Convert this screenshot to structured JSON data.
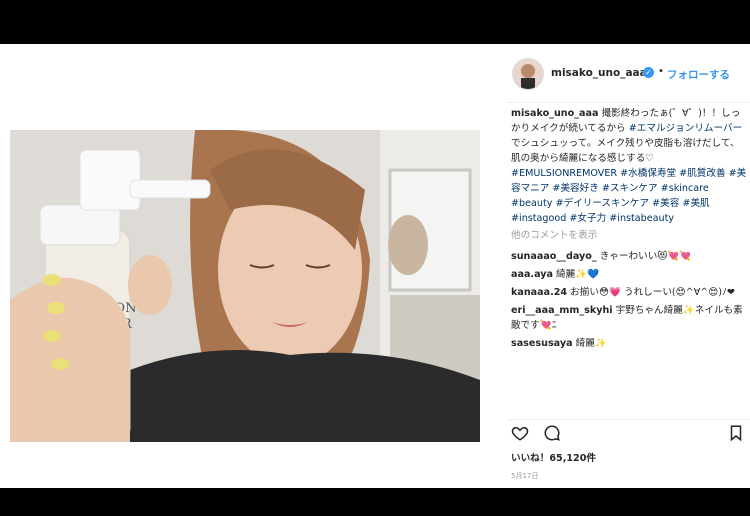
{
  "post": {
    "username": "misako_uno_aaa",
    "verified_icon": "verified-badge-icon",
    "dot": "•",
    "follow_label": "フォローする"
  },
  "caption": {
    "username": "misako_uno_aaa",
    "text": "撮影終わったぁ(゜∀゜)！！しっかりメイクが続いてるから",
    "tag1": "#エマルジョンリムーバー",
    "text2": "でシュシュッって。メイク残りや皮脂も溶けだして、肌の奥から綺麗になる感じする♡",
    "tags": "#EMULSIONREMOVER #水橋保寿堂 #肌質改善 #美容マニア #美容好き #スキンケア #skincare #beauty #デイリースキンケア #美容 #美肌 #instagood #女子力 #instabeauty"
  },
  "more_comments_label": "他のコメントを表示",
  "comments": [
    {
      "user": "sunaaao__dayo_",
      "text": "きゃーわいい😻💘💘"
    },
    {
      "user": "aaa.aya",
      "text": "綺麗✨💙"
    },
    {
      "user": "kanaaa.24",
      "text": "お揃い😳💗 うれしーい(😍^∀^😍)ﾉ❤"
    },
    {
      "user": "eri__aaa_mm_skyhi",
      "text": "宇野ちゃん綺麗✨ネイルも素敵です💘ﾆ"
    },
    {
      "user": "sasesusaya",
      "text": "綺麗✨"
    }
  ],
  "likes_label": "いいね！65,120件",
  "date_label": "5月17日",
  "icons": [
    "heart-icon",
    "comment-icon",
    "bookmark-icon"
  ],
  "photo_text": {
    "line1": "EMULSION",
    "line2": "REMOVER"
  }
}
